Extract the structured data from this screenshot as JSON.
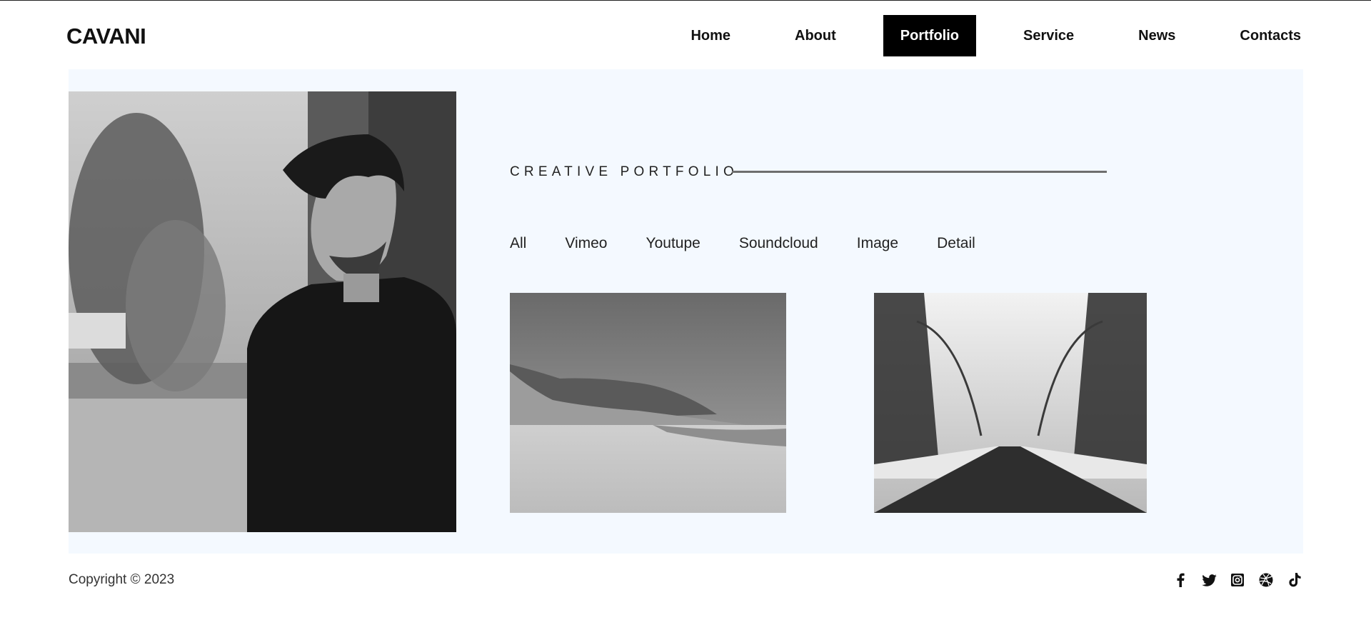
{
  "header": {
    "logo": "CAVANI",
    "nav": [
      {
        "label": "Home",
        "active": false
      },
      {
        "label": "About",
        "active": false
      },
      {
        "label": "Portfolio",
        "active": true
      },
      {
        "label": "Service",
        "active": false
      },
      {
        "label": "News",
        "active": false
      },
      {
        "label": "Contacts",
        "active": false
      }
    ]
  },
  "main": {
    "section_title": "CREATIVE PORTFOLIO",
    "filters": [
      "All",
      "Vimeo",
      "Youtupe",
      "Soundcloud",
      "Image",
      "Detail"
    ]
  },
  "footer": {
    "copyright": "Copyright © 2023",
    "social": [
      "facebook-icon",
      "twitter-icon",
      "instagram-icon",
      "dribbble-icon",
      "tiktok-icon"
    ]
  },
  "colors": {
    "panel_bg": "#f4f9ff",
    "active_nav_bg": "#000000",
    "accent_line": "#6e6e6e"
  }
}
